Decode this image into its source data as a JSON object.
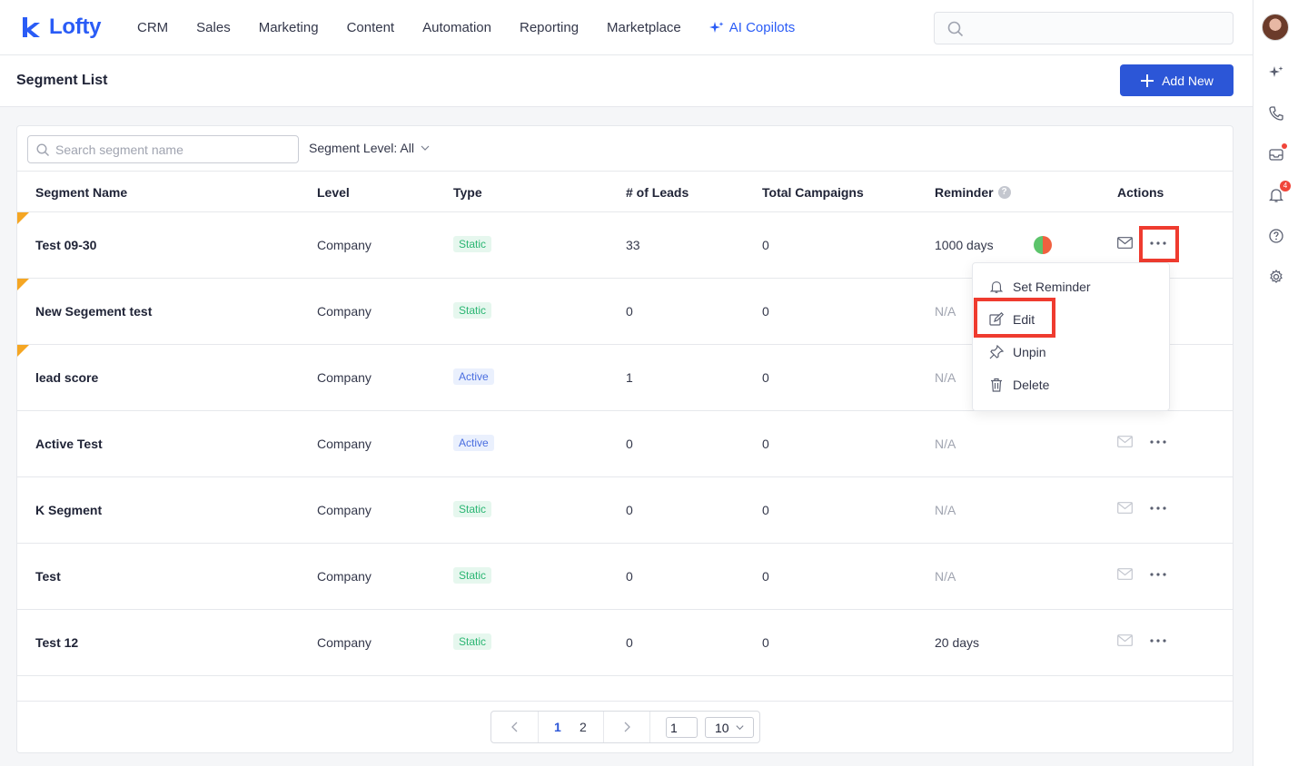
{
  "app": {
    "name": "Lofty",
    "brand_color": "#2a5cf6"
  },
  "nav": {
    "items": [
      "CRM",
      "Sales",
      "Marketing",
      "Content",
      "Automation",
      "Reporting",
      "Marketplace"
    ],
    "ai": "AI Copilots"
  },
  "header": {
    "title": "Segment List",
    "add_label": "Add New"
  },
  "filters": {
    "search_placeholder": "Search segment name",
    "level_label": "Segment Level: All"
  },
  "table": {
    "headers": {
      "name": "Segment Name",
      "level": "Level",
      "type": "Type",
      "leads": "# of Leads",
      "campaigns": "Total Campaigns",
      "reminder": "Reminder",
      "actions": "Actions"
    },
    "rows": [
      {
        "name": "Test 09-30",
        "level": "Company",
        "type": "Static",
        "leads": "33",
        "campaigns": "0",
        "reminder": "1000 days"
      },
      {
        "name": "New Segement test",
        "level": "Company",
        "type": "Static",
        "leads": "0",
        "campaigns": "0",
        "reminder": "N/A"
      },
      {
        "name": "lead score",
        "level": "Company",
        "type": "Active",
        "leads": "1",
        "campaigns": "0",
        "reminder": "N/A"
      },
      {
        "name": "Active Test",
        "level": "Company",
        "type": "Active",
        "leads": "0",
        "campaigns": "0",
        "reminder": "N/A"
      },
      {
        "name": "K Segment",
        "level": "Company",
        "type": "Static",
        "leads": "0",
        "campaigns": "0",
        "reminder": "N/A"
      },
      {
        "name": "Test",
        "level": "Company",
        "type": "Static",
        "leads": "0",
        "campaigns": "0",
        "reminder": "N/A"
      },
      {
        "name": "Test 12",
        "level": "Company",
        "type": "Static",
        "leads": "0",
        "campaigns": "0",
        "reminder": "20 days"
      }
    ]
  },
  "menu": {
    "set_reminder": "Set Reminder",
    "edit": "Edit",
    "unpin": "Unpin",
    "delete": "Delete"
  },
  "pager": {
    "page1": "1",
    "page2": "2",
    "jump": "1",
    "size": "10"
  },
  "sidebar": {
    "notifications_count": "4"
  }
}
